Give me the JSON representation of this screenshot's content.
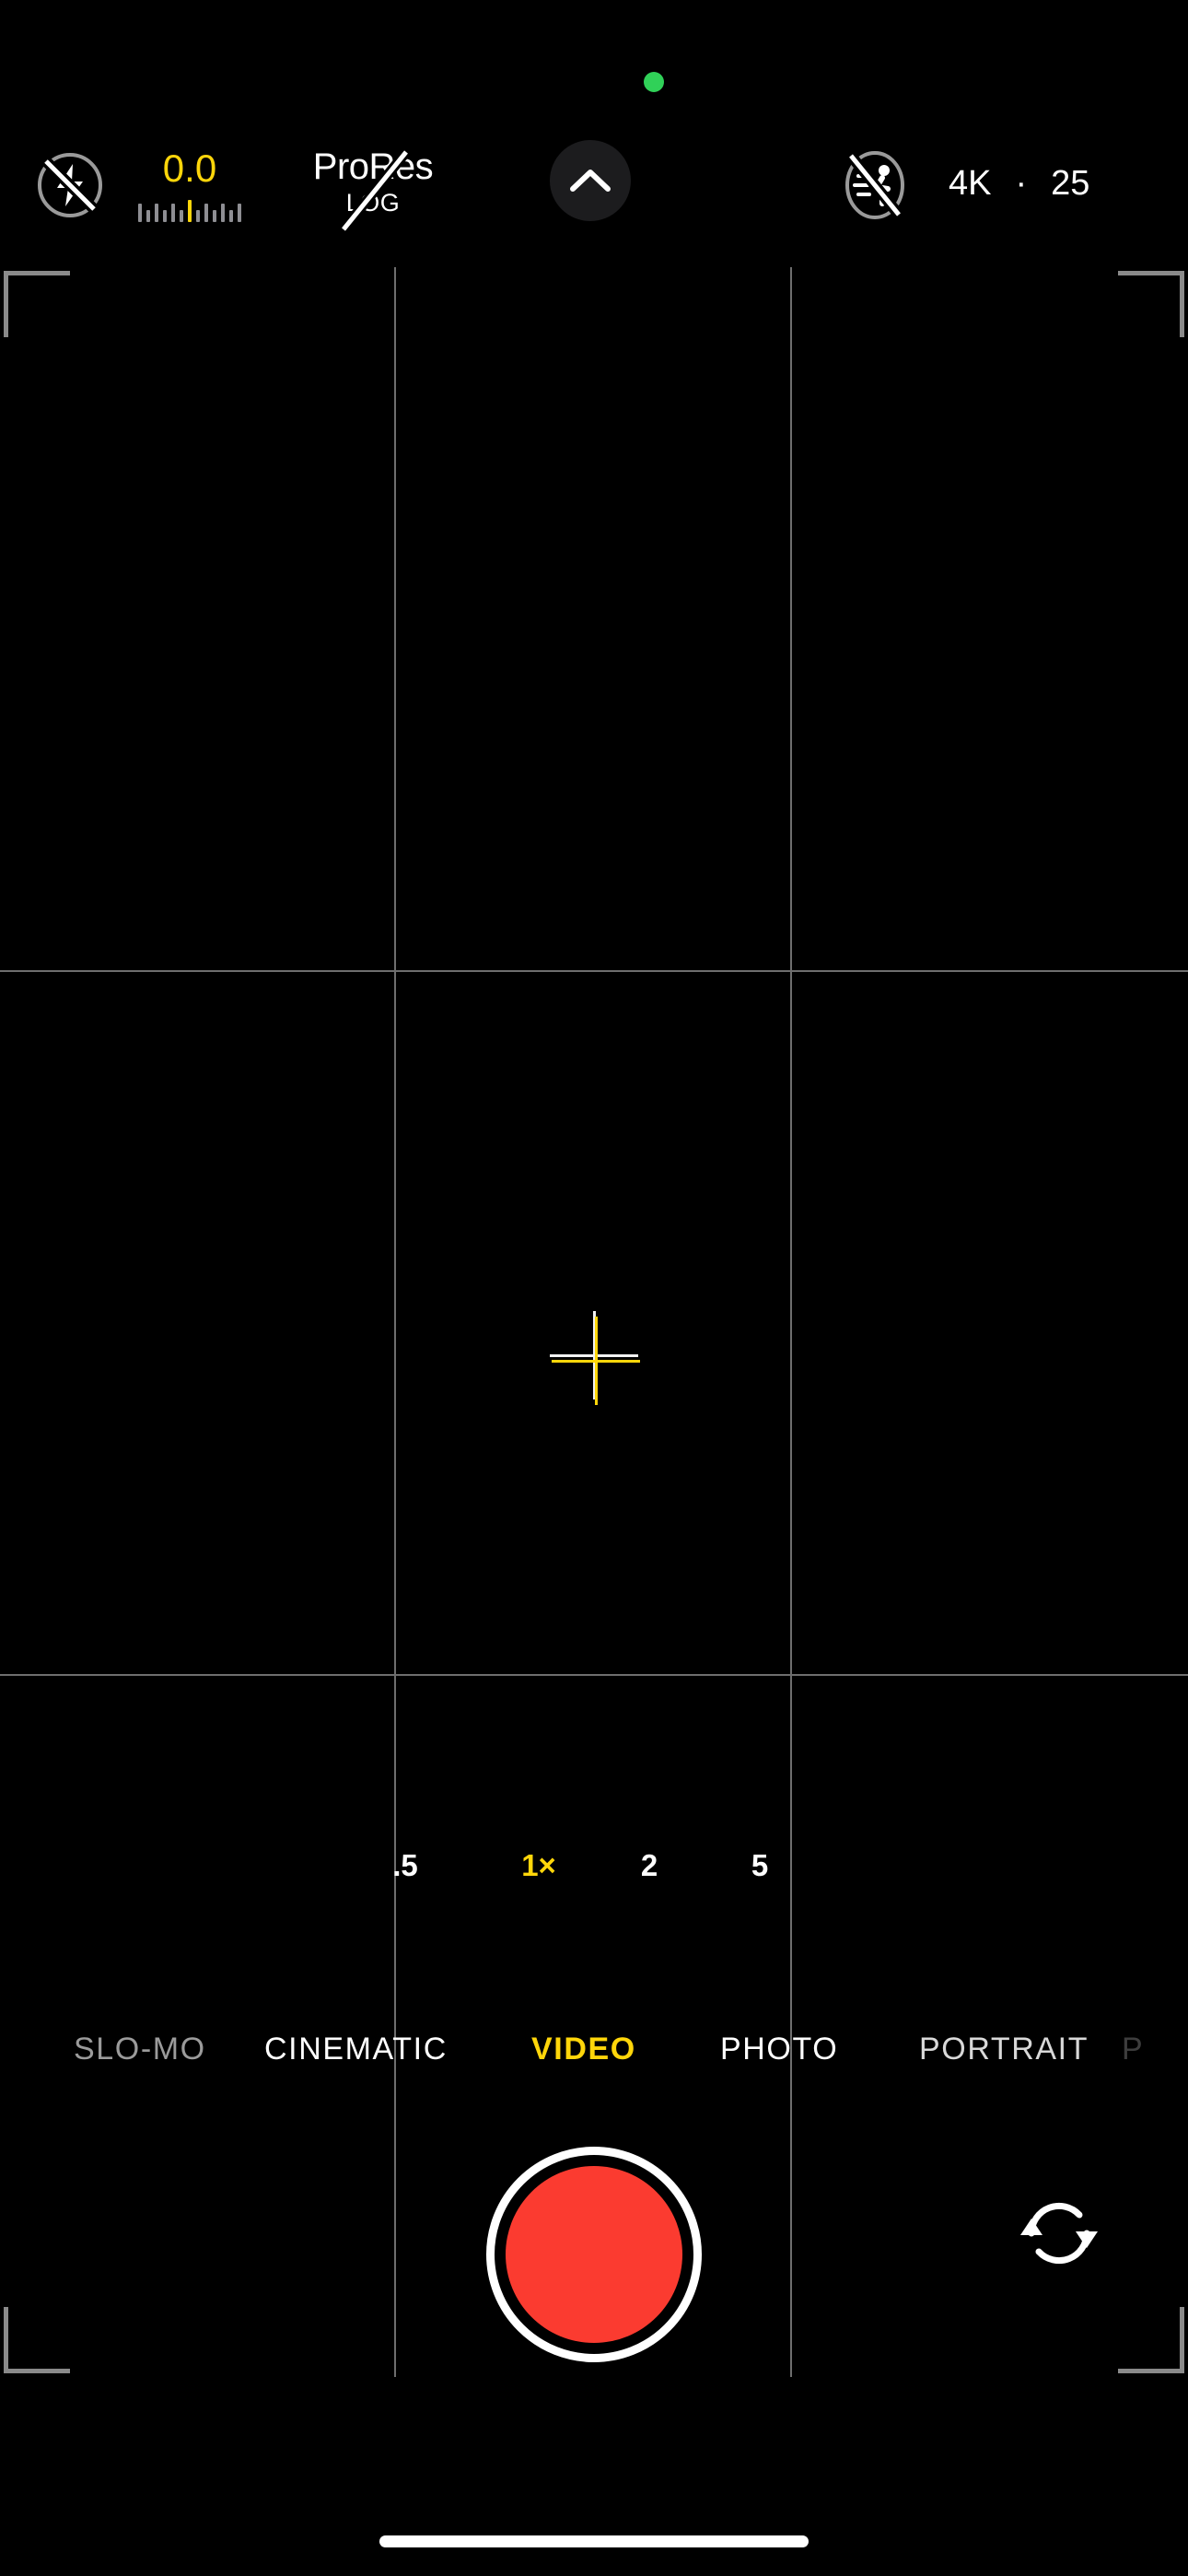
{
  "app": {
    "name": "Camera",
    "privacy_indicator": {
      "name": "camera-in-use-dot",
      "color": "#30d158"
    }
  },
  "colors": {
    "accent_yellow": "#ffd60a",
    "record_red": "#fb3b30",
    "grid_gray": "#6e6e6e",
    "inactive_gray": "#9b9b9b",
    "background": "#000000"
  },
  "top_bar": {
    "flash": {
      "icon": "flash-off-icon",
      "state": "off",
      "label": "Flash Off"
    },
    "exposure": {
      "icon": "exposure-ruler",
      "value": "0.0",
      "ticks": [
        "tall",
        "short",
        "tall",
        "short",
        "tall",
        "short",
        "active",
        "short",
        "tall",
        "short",
        "tall",
        "short",
        "tall"
      ]
    },
    "prores": {
      "icon": "prores-log-off-icon",
      "line1": "ProRes",
      "line2": "LOG",
      "state": "off"
    },
    "expand": {
      "icon": "chevron-up-icon",
      "label": "More Controls"
    },
    "action_mode": {
      "icon": "action-mode-off-icon",
      "state": "off",
      "label": "Action Mode Off"
    },
    "resolution": "4K",
    "separator": "·",
    "frame_rate": "25"
  },
  "viewfinder": {
    "grid": {
      "enabled": true,
      "vertical_lines": 2,
      "horizontal_lines": 2
    },
    "frame_corners": [
      "top-left",
      "top-right",
      "bottom-left",
      "bottom-right"
    ],
    "level_indicator": {
      "icon": "level-crosshair-icon",
      "aligned": false
    }
  },
  "zoom": {
    "options": [
      {
        "label": ".5",
        "active": false
      },
      {
        "label": "1×",
        "active": true
      },
      {
        "label": "2",
        "active": false
      },
      {
        "label": "5",
        "active": false
      }
    ]
  },
  "modes": {
    "items": [
      {
        "label": "SLO-MO",
        "active": false
      },
      {
        "label": "CINEMATIC",
        "active": false
      },
      {
        "label": "VIDEO",
        "active": true
      },
      {
        "label": "PHOTO",
        "active": false
      },
      {
        "label": "PORTRAIT",
        "active": false
      },
      {
        "label": "P",
        "active": false
      }
    ]
  },
  "controls": {
    "shutter": {
      "icon": "record-button",
      "label": "Record",
      "state": "idle"
    },
    "flip_camera": {
      "icon": "camera-flip-icon",
      "label": "Flip Camera"
    }
  },
  "system": {
    "home_indicator": "home-indicator-bar"
  }
}
